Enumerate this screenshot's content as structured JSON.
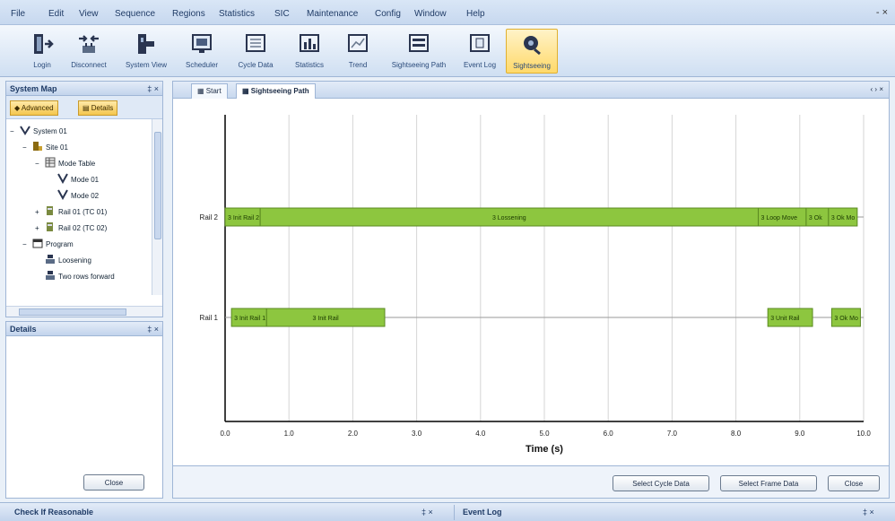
{
  "menu": [
    "File",
    "Edit",
    "View",
    "Sequence",
    "Regions",
    "Statistics",
    "SIC",
    "Maintenance",
    "Config",
    "Window",
    "Help"
  ],
  "window_controls": "- ×",
  "toolbar": [
    {
      "label": "Login",
      "icon": "door-arrow-icon"
    },
    {
      "label": "Disconnect",
      "icon": "plug-arrows-icon"
    },
    {
      "label": "System View",
      "icon": "system-view-icon"
    },
    {
      "label": "Scheduler",
      "icon": "monitor-icon"
    },
    {
      "label": "Cycle Data",
      "icon": "data-window-icon"
    },
    {
      "label": "Statistics",
      "icon": "bar-chart-icon"
    },
    {
      "label": "Trend",
      "icon": "trend-window-icon"
    },
    {
      "label": "Sightseeing Path",
      "icon": "path-window-icon"
    },
    {
      "label": "Event Log",
      "icon": "event-log-icon"
    },
    {
      "label": "Sightseeing",
      "icon": "eye-icon"
    }
  ],
  "nav": {
    "title": "System Map",
    "pin": "‡ ×",
    "buttons": [
      "◆ Advanced",
      "▤ Details"
    ],
    "tree": [
      {
        "label": "System 01",
        "level": 0,
        "icon": "system-icon",
        "exp": "−"
      },
      {
        "label": "Site 01",
        "level": 1,
        "icon": "site-icon",
        "exp": "−"
      },
      {
        "label": "Mode Table",
        "level": 2,
        "icon": "table-icon",
        "exp": "−"
      },
      {
        "label": "Mode 01",
        "level": 3,
        "icon": "mode-icon",
        "exp": ""
      },
      {
        "label": "Mode 02",
        "level": 3,
        "icon": "mode-icon",
        "exp": ""
      },
      {
        "label": "Rail 01 (TC 01)",
        "level": 2,
        "icon": "rail-icon",
        "exp": "+"
      },
      {
        "label": "Rail 02 (TC 02)",
        "level": 2,
        "icon": "rail-icon",
        "exp": "+"
      },
      {
        "label": "Program",
        "level": 1,
        "icon": "program-icon",
        "exp": "−"
      },
      {
        "label": "Loosening",
        "level": 2,
        "icon": "sequence-icon",
        "exp": ""
      },
      {
        "label": "Two rows forward",
        "level": 2,
        "icon": "sequence-icon",
        "exp": ""
      }
    ]
  },
  "details": {
    "title": "Details",
    "pin": "‡ ×",
    "close_label": "Close"
  },
  "tabs": [
    {
      "label": "▦ Start",
      "active": false
    },
    {
      "label": "▦ Sightseeing Path",
      "active": true
    }
  ],
  "tab_controls": "‹ › ×",
  "chart_data": {
    "type": "gantt",
    "xlabel": "Time (s)",
    "xlim": [
      0,
      10
    ],
    "xticks": [
      "0.0",
      "1.0",
      "2.0",
      "3.0",
      "4.0",
      "5.0",
      "6.0",
      "7.0",
      "8.0",
      "9.0",
      "10.0"
    ],
    "rows": [
      "Rail 2",
      "Rail 1"
    ],
    "bar_color": "#8dc63f",
    "bars": [
      {
        "row": "Rail 2",
        "start": 0.0,
        "end": 0.55,
        "label": "3 Init Rail 2"
      },
      {
        "row": "Rail 2",
        "start": 0.55,
        "end": 8.35,
        "label": "3 Lossening"
      },
      {
        "row": "Rail 2",
        "start": 8.35,
        "end": 9.1,
        "label": "3 Loop Move"
      },
      {
        "row": "Rail 2",
        "start": 9.1,
        "end": 9.45,
        "label": "3 Ok"
      },
      {
        "row": "Rail 2",
        "start": 9.45,
        "end": 9.9,
        "label": "3 Ok Move"
      },
      {
        "row": "Rail 1",
        "start": 0.1,
        "end": 0.65,
        "label": "3 Init Rail 1"
      },
      {
        "row": "Rail 1",
        "start": 0.65,
        "end": 2.5,
        "label": "3 Init Rail"
      },
      {
        "row": "Rail 1",
        "start": 8.5,
        "end": 9.2,
        "label": "3 Unit Rail"
      },
      {
        "row": "Rail 1",
        "start": 9.5,
        "end": 9.95,
        "label": "3 Ok Move"
      }
    ]
  },
  "buttons": [
    "Select Cycle Data",
    "Select Frame Data",
    "Close"
  ],
  "bottom": {
    "left_title": "Check If Reasonable",
    "left_pin": "‡ ×",
    "right_title": "Event Log",
    "right_pin": "‡ ×"
  }
}
